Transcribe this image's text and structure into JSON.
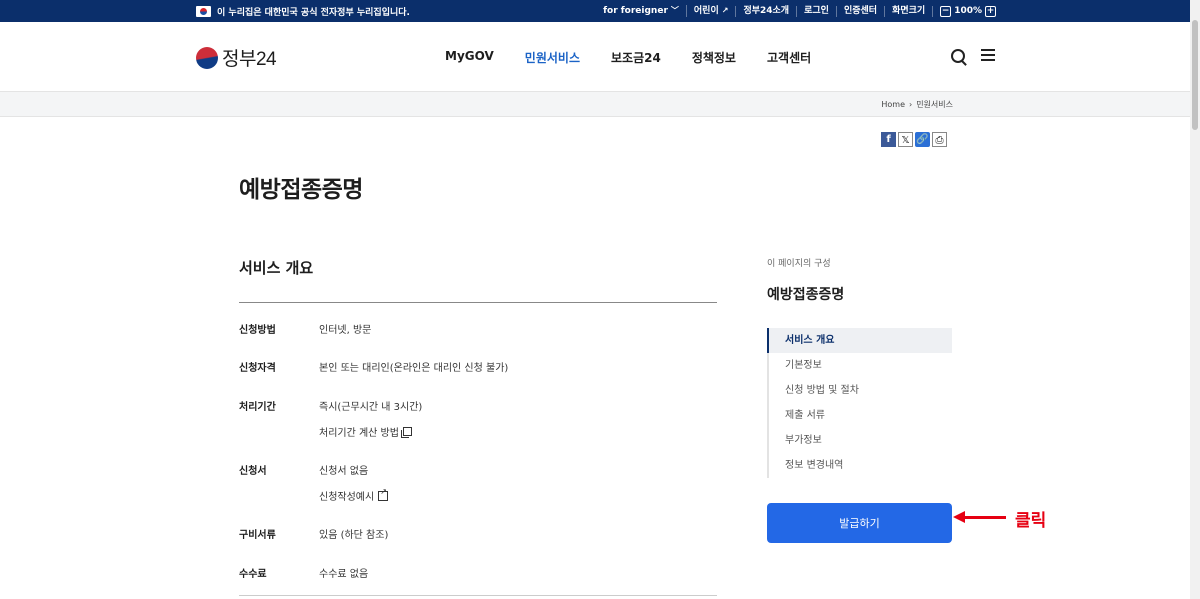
{
  "topbar": {
    "notice": "이 누리집은 대한민국 공식 전자정부 누리집입니다.",
    "for_foreigner": "for foreigner",
    "kids": "어린이",
    "about": "정부24소개",
    "login": "로그인",
    "cert": "인증센터",
    "zoom_label": "화면크기",
    "zoom_value": "100%",
    "zoom_minus": "−",
    "zoom_plus": "+"
  },
  "header": {
    "logo_text": "정부24",
    "nav": [
      "MyGOV",
      "민원서비스",
      "보조금24",
      "정책정보",
      "고객센터"
    ]
  },
  "breadcrumb": {
    "home": "Home",
    "current": "민원서비스"
  },
  "page_title": "예방접종증명",
  "section_title": "서비스 개요",
  "rows": {
    "method_label": "신청방법",
    "method_value": "인터넷, 방문",
    "eligibility_label": "신청자격",
    "eligibility_value": "본인 또는 대리인(온라인은 대리인 신청 불가)",
    "period_label": "처리기간",
    "period_value": "즉시(근무시간 내 3시간)",
    "period_link": "처리기간 계산 방법",
    "form_label": "신청서",
    "form_value": "신청서 없음",
    "form_link": "신청작성예시",
    "docs_label": "구비서류",
    "docs_value": "있음 (하단 참조)",
    "fee_label": "수수료",
    "fee_value": "수수료 없음"
  },
  "side": {
    "caption": "이 페이지의 구성",
    "title": "예방접종증명",
    "items": [
      "서비스 개요",
      "기본정보",
      "신청 방법 및 절차",
      "제출 서류",
      "부가정보",
      "정보 변경내역"
    ]
  },
  "issue_button": "발급하기",
  "annotation": {
    "label": "클릭",
    "color": "#e60012"
  },
  "colors": {
    "topbar": "#0b2f6b",
    "nav_active": "#1b63c6",
    "button": "#2368e6"
  }
}
